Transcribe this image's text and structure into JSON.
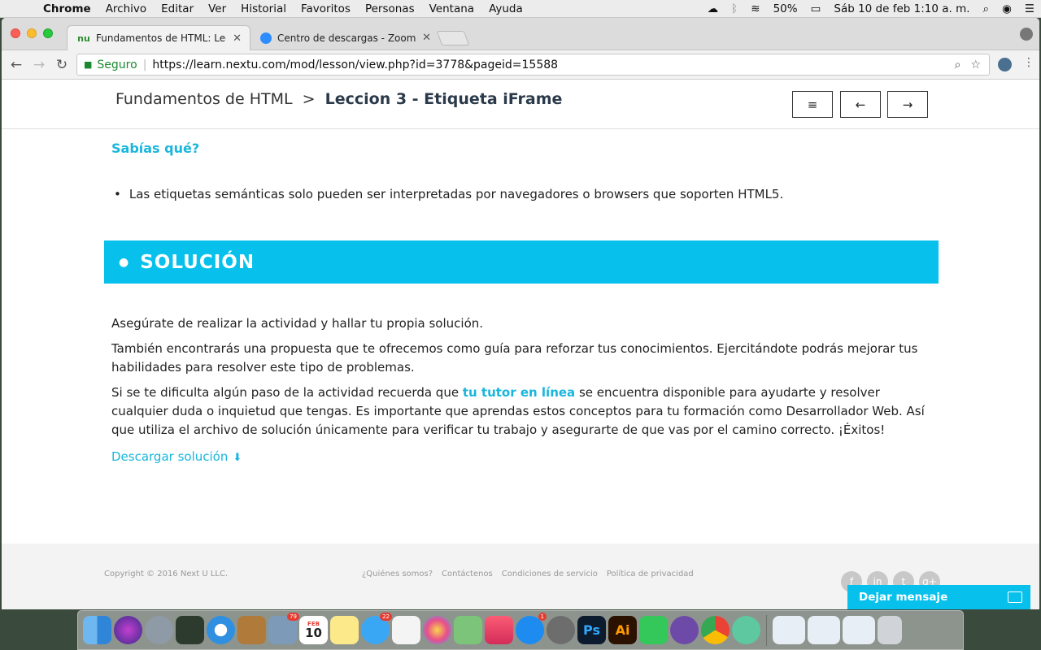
{
  "menubar": {
    "app_name": "Chrome",
    "items": [
      "Archivo",
      "Editar",
      "Ver",
      "Historial",
      "Favoritos",
      "Personas",
      "Ventana",
      "Ayuda"
    ],
    "battery": "50%",
    "datetime": "Sáb 10 de feb  1:10 a. m."
  },
  "browser": {
    "tabs": [
      {
        "title": "Fundamentos de HTML: Leccio",
        "favicon": "nu"
      },
      {
        "title": "Centro de descargas - Zoom",
        "favicon": "zoom-icon"
      }
    ],
    "tab_close": "✕",
    "secure_label": "Seguro",
    "url": "https://learn.nextu.com/mod/lesson/view.php?id=3778&pageid=15588"
  },
  "lesson": {
    "breadcrumb_parent": "Fundamentos de HTML",
    "breadcrumb_sep": ">",
    "breadcrumb_current": "Leccion 3 - Etiqueta iFrame",
    "menu_glyph": "≡",
    "prev_glyph": "←",
    "next_glyph": "→"
  },
  "content": {
    "did_you_know": "Sabías qué?",
    "bullets": [
      "Las etiquetas semánticas solo pueden ser interpretadas por navegadores o browsers que soporten HTML5."
    ],
    "solution_title": "SOLUCIÓN",
    "para1": "Asegúrate de realizar la actividad y hallar tu propia solución.",
    "para2": "También encontrarás una propuesta que te ofrecemos como guía para reforzar tus conocimientos. Ejercitándote podrás mejorar tus habilidades para resolver este tipo de problemas.",
    "para3_before": "Si se te dificulta algún paso de la actividad recuerda que ",
    "para3_link": "tu tutor en línea",
    "para3_after": " se encuentra disponible para ayudarte y resolver cualquier duda o inquietud que tengas. Es importante que aprendas estos conceptos para tu formación como Desarrollador Web. Así que utiliza el archivo de solución únicamente para verificar tu trabajo y asegurarte de que vas por el camino correcto. ¡Éxitos!",
    "download_label": "Descargar solución"
  },
  "footer": {
    "copyright": "Copyright © 2016 Next U LLC.",
    "links": [
      "¿Quiénes somos?",
      "Contáctenos",
      "Condiciones de servicio",
      "Política de privacidad"
    ],
    "socials": [
      "f",
      "in",
      "t",
      "g+"
    ],
    "chat_label": "Dejar mensaje"
  },
  "dock": {
    "calendar_month": "FEB",
    "calendar_day": "10",
    "badges": {
      "mail": "79",
      "messages": "22",
      "appstore": "1"
    }
  },
  "colors": {
    "accent": "#07c1ec",
    "link": "#19b6dd"
  }
}
